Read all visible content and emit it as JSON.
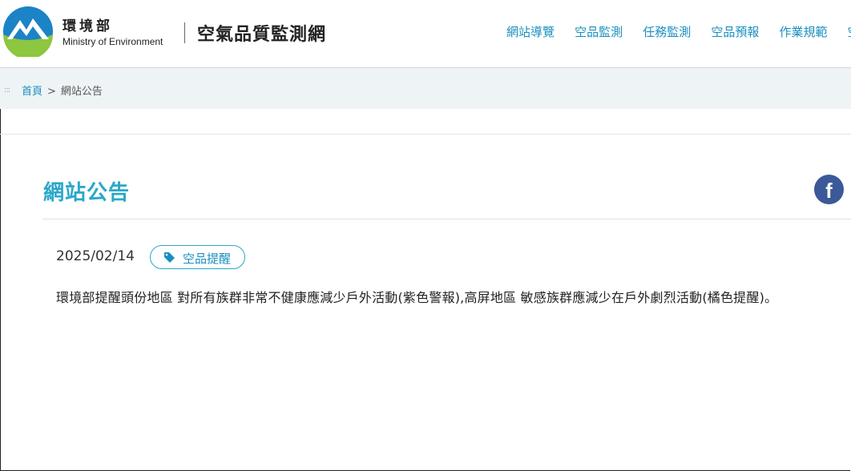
{
  "header": {
    "ministry_zh": "環境部",
    "ministry_en": "Ministry of Environment",
    "site_title": "空氣品質監測網",
    "nav": [
      "網站導覽",
      "空品監測",
      "任務監測",
      "空品預報",
      "作業規範",
      "空"
    ]
  },
  "breadcrumb": {
    "home": "首頁",
    "separator": ">",
    "current": "網站公告"
  },
  "main": {
    "title": "網站公告",
    "social_icon": "facebook-icon",
    "announcement": {
      "date": "2025/02/14",
      "tag_icon": "tag-icon",
      "tag": "空品提醒",
      "content": "環境部提醒頭份地區 對所有族群非常不健康應減少戶外活動(紫色警報),高屏地區 敏感族群應減少在戶外劇烈活動(橘色提醒)。"
    }
  },
  "colors": {
    "accent": "#29a8c8",
    "link": "#1a8fbf",
    "breadcrumb_bg": "#eef3f6",
    "facebook": "#3b5998"
  }
}
